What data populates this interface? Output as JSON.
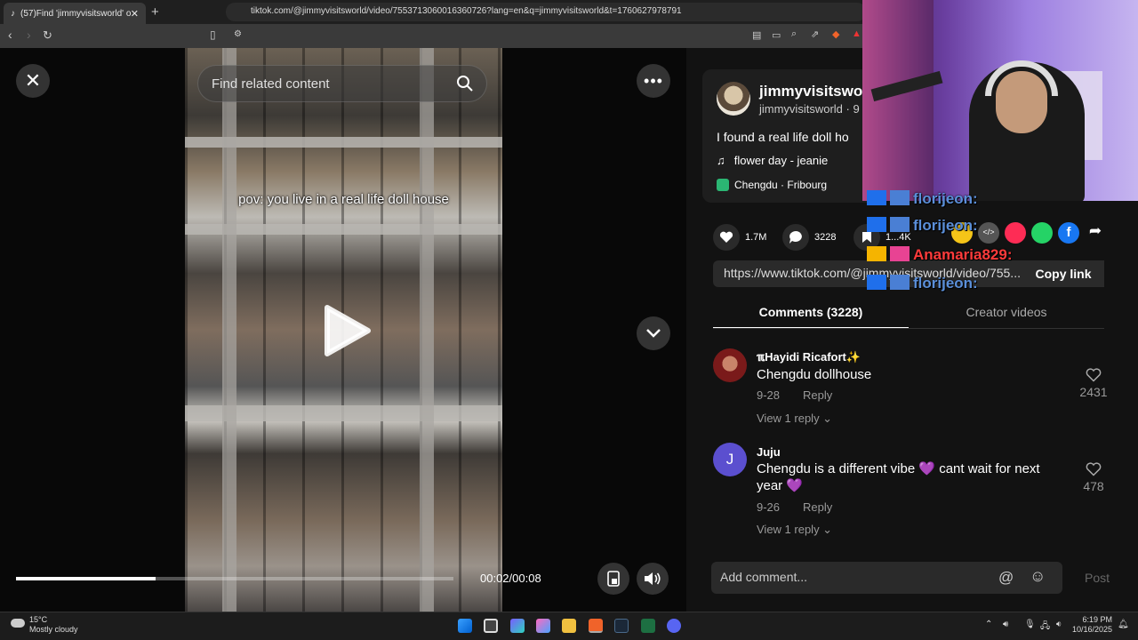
{
  "browser": {
    "tab_title": "(57)Find 'jimmyvisitsworld' o",
    "url": "tiktok.com/@jimmyvisitsworld/video/7553713060016360726?lang=en&q=jimmyvisitsworld&t=1760627978791"
  },
  "video": {
    "search_placeholder": "Find related content",
    "overlay_text": "pov: you live in a real life doll house",
    "time": "00:02/00:08",
    "progress": 0.32
  },
  "post": {
    "username": "jimmyvisitswo",
    "handle": "jimmyvisitsworld · 9",
    "description": "I found a real life doll ho",
    "music": "flower day - jeanie",
    "location": "Chengdu · Fribourg",
    "likes": "1.7M",
    "comments": "3228",
    "saves": "1...4K",
    "link": "https://www.tiktok.com/@jimmyvisitsworld/video/755...",
    "copy_label": "Copy link"
  },
  "chat": [
    {
      "user": "florijeon:",
      "color": "#5b8fd9"
    },
    {
      "user": "Anamaria829:",
      "color": "#ff3b3b"
    },
    {
      "user": "florijeon:",
      "color": "#5b8fd9"
    }
  ],
  "tabs": {
    "comments": "Comments (3228)",
    "creator": "Creator videos"
  },
  "comment_list": [
    {
      "name": "ℼHayidi Ricafort✨",
      "text": "Chengdu dollhouse",
      "date": "9-28",
      "reply": "Reply",
      "view": "View 1 reply ⌄",
      "likes": "2431",
      "avatar_letter": ""
    },
    {
      "name": "Juju",
      "text": "Chengdu is a different vibe 💜 cant wait for next year 💜",
      "date": "9-26",
      "reply": "Reply",
      "view": "View 1 reply ⌄",
      "likes": "478",
      "avatar_letter": "J"
    }
  ],
  "comment_input": {
    "placeholder": "Add comment...",
    "post_label": "Post"
  },
  "taskbar": {
    "temperature": "15°C",
    "weather": "Mostly cloudy",
    "time": "6:19 PM",
    "date": "10/16/2025"
  }
}
